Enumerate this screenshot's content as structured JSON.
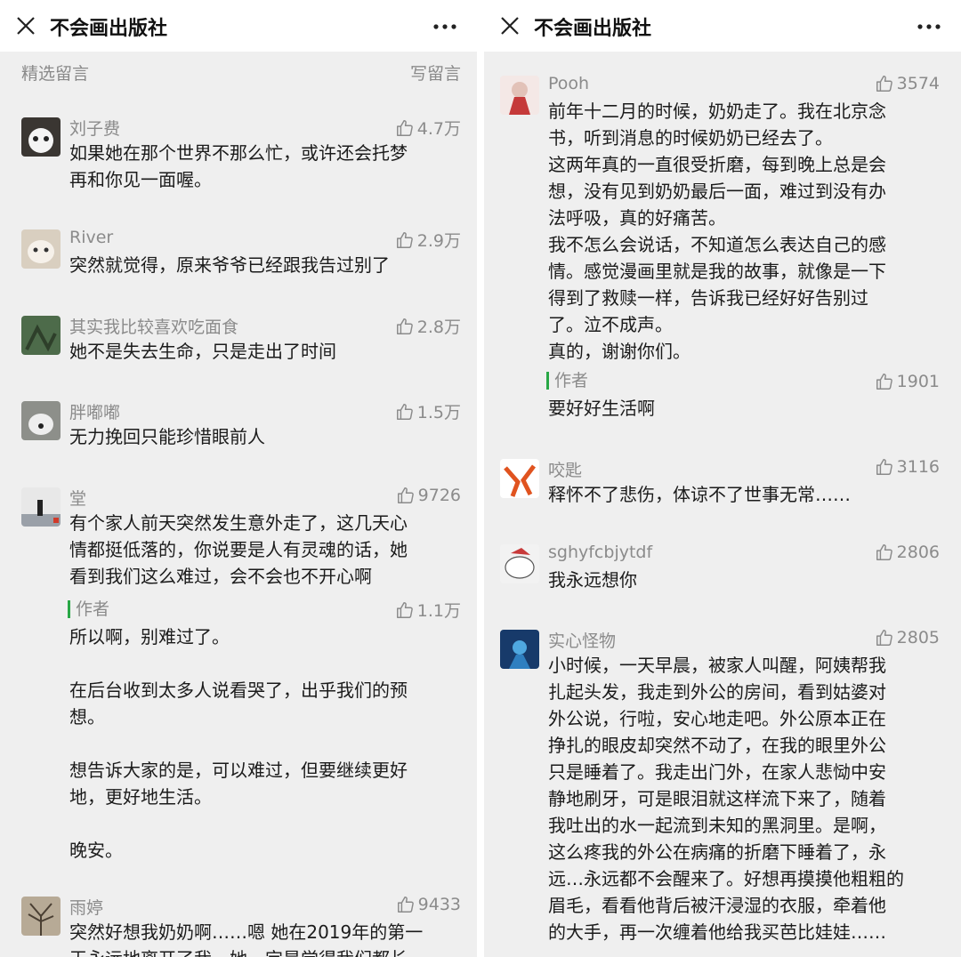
{
  "left": {
    "header_title": "不会画出版社",
    "section_label": "精选留言",
    "write_comment": "写留言",
    "comments": [
      {
        "name": "刘子费",
        "likes": "4.7万",
        "text": "如果她在那个世界不那么忙，或许还会托梦\n再和你见一面喔。"
      },
      {
        "name": "River",
        "likes": "2.9万",
        "text": "突然就觉得，原来爷爷已经跟我告过别了"
      },
      {
        "name": "其实我比较喜欢吃面食",
        "likes": "2.8万",
        "text": "她不是失去生命，只是走出了时间"
      },
      {
        "name": "胖嘟嘟",
        "likes": "1.5万",
        "text": "无力挽回只能珍惜眼前人"
      },
      {
        "name": "堂",
        "likes": "9726",
        "text": "有个家人前天突然发生意外走了，这几天心\n情都挺低落的，你说要是人有灵魂的话，她\n看到我们这么难过，会不会也不开心啊",
        "reply": {
          "label": "作者",
          "likes": "1.1万",
          "text": "所以啊，别难过了。\n\n在后台收到太多人说看哭了，出乎我们的预\n想。\n\n想告诉大家的是，可以难过，但要继续更好\n地，更好地生活。\n\n晚安。"
        }
      },
      {
        "name": "雨婷",
        "likes": "9433",
        "text": "突然好想我奶奶啊……嗯 她在2019年的第一\n天永远地离开了我，她一定是觉得我们都长"
      }
    ]
  },
  "right": {
    "header_title": "不会画出版社",
    "comments": [
      {
        "name": "Pooh",
        "likes": "3574",
        "text": "前年十二月的时候，奶奶走了。我在北京念\n书，听到消息的时候奶奶已经去了。\n这两年真的一直很受折磨，每到晚上总是会\n想，没有见到奶奶最后一面，难过到没有办\n法呼吸，真的好痛苦。\n我不怎么会说话，不知道怎么表达自己的感\n情。感觉漫画里就是我的故事，就像是一下\n得到了救赎一样，告诉我已经好好告别过\n了。泣不成声。\n真的，谢谢你们。",
        "reply": {
          "label": "作者",
          "likes": "1901",
          "text": "要好好生活啊"
        }
      },
      {
        "name": "咬匙",
        "likes": "3116",
        "text": "释怀不了悲伤，体谅不了世事无常……"
      },
      {
        "name": "sghyfcbjytdf",
        "likes": "2806",
        "text": "我永远想你"
      },
      {
        "name": "实心怪物",
        "likes": "2805",
        "text": "小时候，一天早晨，被家人叫醒，阿姨帮我\n扎起头发，我走到外公的房间，看到姑婆对\n外公说，行啦，安心地走吧。外公原本正在\n挣扎的眼皮却突然不动了，在我的眼里外公\n只是睡着了。我走出门外，在家人悲恸中安\n静地刷牙，可是眼泪就这样流下来了，随着\n我吐出的水一起流到未知的黑洞里。是啊，\n这么疼我的外公在病痛的折磨下睡着了，永\n远…永远都不会醒来了。好想再摸摸他粗粗的\n眉毛，看看他背后被汗浸湿的衣服，牵着他\n的大手，再一次缠着他给我买芭比娃娃……"
      }
    ]
  },
  "colors": {
    "accent": "#28a745",
    "background": "#efefef",
    "secondary_text": "#8b8b8b"
  }
}
